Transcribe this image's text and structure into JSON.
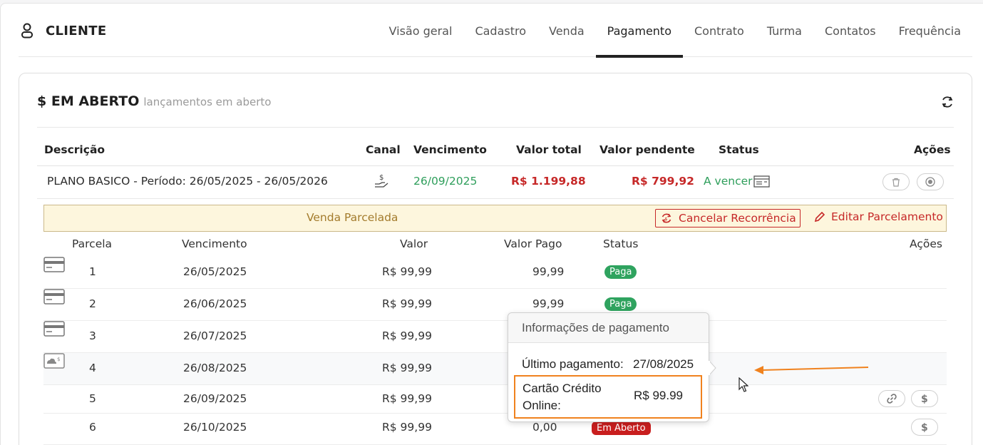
{
  "header": {
    "title": "CLIENTE",
    "tabs": [
      {
        "label": "Visão geral"
      },
      {
        "label": "Cadastro"
      },
      {
        "label": "Venda"
      },
      {
        "label": "Pagamento",
        "active": true
      },
      {
        "label": "Contrato"
      },
      {
        "label": "Turma"
      },
      {
        "label": "Contatos"
      },
      {
        "label": "Frequência"
      }
    ]
  },
  "panel": {
    "title": "$ EM ABERTO",
    "subtitle": "lançamentos em aberto",
    "columns": {
      "descricao": "Descrição",
      "canal": "Canal",
      "vencimento": "Vencimento",
      "valor_total": "Valor total",
      "valor_pendente": "Valor pendente",
      "status": "Status",
      "acoes": "Ações"
    },
    "row": {
      "descricao": "PLANO BASICO - Período: 26/05/2025 - 26/05/2026",
      "vencimento": "26/09/2025",
      "valor_total": "R$ 1.199,88",
      "valor_pendente": "R$ 799,92",
      "status": "A vencer"
    }
  },
  "parcelamento": {
    "banner_label": "Venda Parcelada",
    "cancelar_label": "Cancelar Recorrência",
    "editar_label": "Editar Parcelamento",
    "columns": {
      "parcela": "Parcela",
      "vencimento": "Vencimento",
      "valor": "Valor",
      "valor_pago": "Valor Pago",
      "status": "Status",
      "acoes": "Ações"
    },
    "rows": [
      {
        "parcela": "1",
        "vencimento": "26/05/2025",
        "valor": "R$ 99,99",
        "valor_pago": "99,99",
        "status": "Paga"
      },
      {
        "parcela": "2",
        "vencimento": "26/06/2025",
        "valor": "R$ 99,99",
        "valor_pago": "99,99",
        "status": "Paga"
      },
      {
        "parcela": "3",
        "vencimento": "26/07/2025",
        "valor": "R$ 99,99",
        "valor_pago": "",
        "status": ""
      },
      {
        "parcela": "4",
        "vencimento": "26/08/2025",
        "valor": "R$ 99,99",
        "valor_pago": "",
        "status": ""
      },
      {
        "parcela": "5",
        "vencimento": "26/09/2025",
        "valor": "R$ 99,99",
        "valor_pago": "",
        "status": ""
      },
      {
        "parcela": "6",
        "vencimento": "26/10/2025",
        "valor": "R$ 99,99",
        "valor_pago": "0,00",
        "status": "Em Aberto"
      }
    ]
  },
  "popover": {
    "title": "Informações de pagamento",
    "ultimo_label": "Último pagamento:",
    "ultimo_value": "27/08/2025",
    "metodo_label_1": "Cartão Crédito",
    "metodo_label_2": "Online:",
    "metodo_value": "R$ 99.99"
  },
  "colors": {
    "accent_red": "#c62828",
    "green": "#2e9e5b",
    "badge_paga": "#2fa35f",
    "badge_aberto": "#c81e1e",
    "highlight_orange": "#f0821e",
    "banner_bg": "#fdf6dd"
  }
}
